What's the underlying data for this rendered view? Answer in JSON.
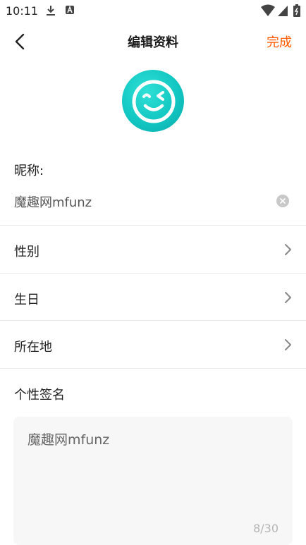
{
  "status": {
    "time": "10:11"
  },
  "nav": {
    "title": "编辑资料",
    "done": "完成"
  },
  "nickname": {
    "label": "昵称:",
    "value": "魔趣网mfunz"
  },
  "rows": [
    {
      "label": "性别"
    },
    {
      "label": "生日"
    },
    {
      "label": "所在地"
    }
  ],
  "signature": {
    "label": "个性签名",
    "value": "魔趣网mfunz",
    "counter": "8/30"
  },
  "colors": {
    "accent": "#ff5a00",
    "avatar": "#12c7c2"
  }
}
